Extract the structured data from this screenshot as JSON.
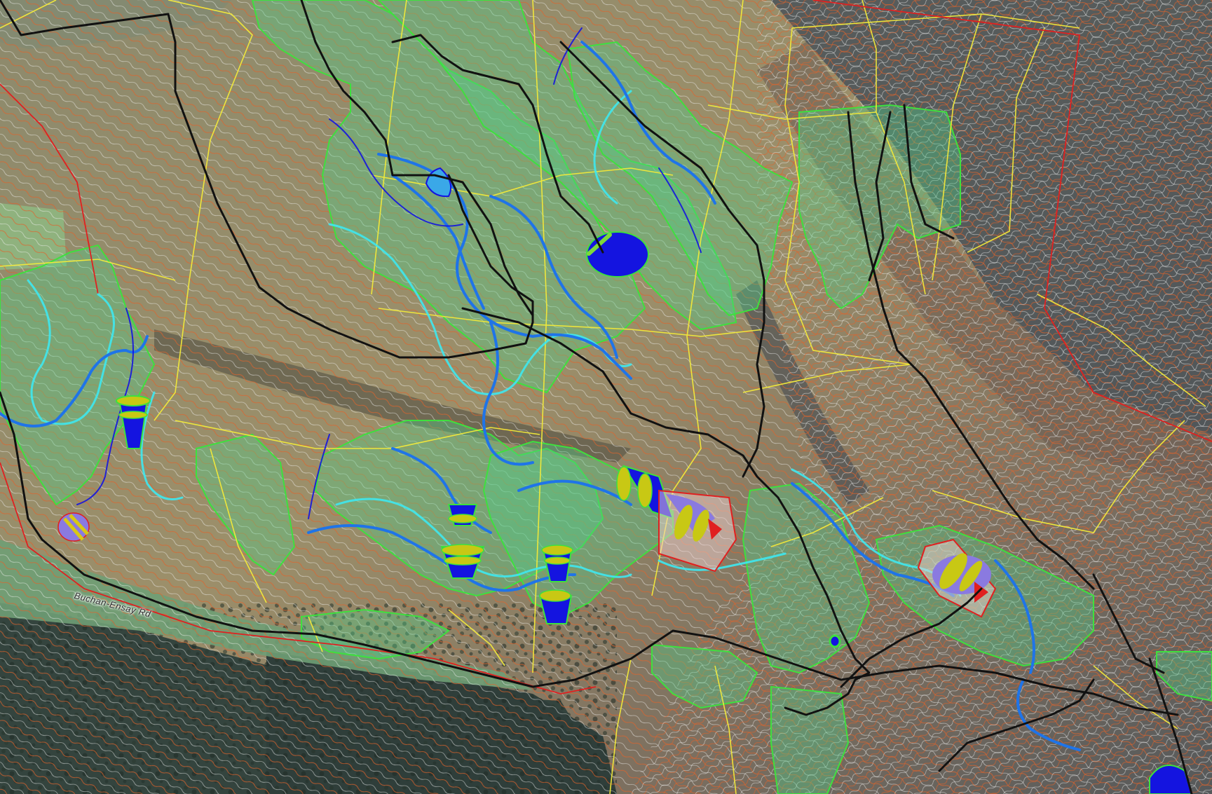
{
  "map": {
    "road_label": "Buchan-Ensay Rd",
    "colors": {
      "terrain_light": "#9c8f6a",
      "terrain_dark": "#3e4a50",
      "pasture": "#8fb27e",
      "contour_orange": "#e0622a",
      "contour_white": "#f2f2f2",
      "green_zone_fill": "#4fd08a",
      "green_zone_edge": "#3ee03e",
      "paddock_line": "#f3ea3a",
      "track_line": "#111111",
      "boundary_line": "#e02020",
      "channel_blue": "#1f74e8",
      "channel_cyan": "#3ee8f0",
      "dam_blue": "#1414e0",
      "dam_marker": "#c8c814"
    },
    "layers": [
      {
        "name": "aerial-imagery"
      },
      {
        "name": "contours"
      },
      {
        "name": "green-zones"
      },
      {
        "name": "paddock-boundaries"
      },
      {
        "name": "property-boundary"
      },
      {
        "name": "water-channels"
      },
      {
        "name": "dams"
      },
      {
        "name": "tracks"
      }
    ]
  }
}
